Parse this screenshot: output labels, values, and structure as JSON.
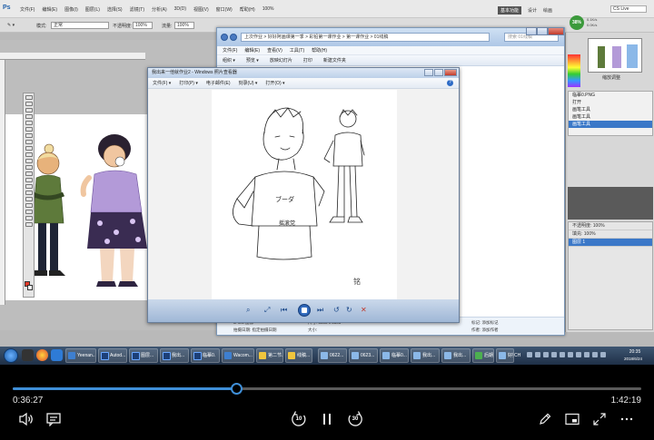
{
  "photoshop": {
    "logo": "Ps",
    "menus": [
      "文件(F)",
      "编辑(E)",
      "图像(I)",
      "图层(L)",
      "选择(S)",
      "滤镜(T)",
      "分析(A)",
      "3D(D)",
      "视图(V)",
      "窗口(W)",
      "帮助(H)"
    ],
    "workspace": {
      "active": "基本功能",
      "items": [
        "设计",
        "绘画"
      ]
    },
    "search_label": "CS Live",
    "zoom": "100%",
    "network": {
      "percent": "38%",
      "speed_up": "0.1K/s",
      "speed_down": "0.0K/s"
    },
    "options": {
      "mode_label": "模式:",
      "mode_value": "正常",
      "opacity_label": "不透明度:",
      "opacity_value": "100%",
      "flow_label": "流量:",
      "flow_value": "100%"
    },
    "navigator_caption": "缩放调整",
    "history": [
      "打开",
      "画笔工具",
      "画笔工具",
      "画笔工具"
    ],
    "history_file": "临摹0.PNG",
    "layers": {
      "opacity_label": "不透明度:",
      "opacity_value": "100%",
      "fill_label": "填充:",
      "fill_value": "100%",
      "layer_name": "图层 1"
    }
  },
  "explorer": {
    "address": "上次作业 > 好好阿画课第一季 > 彩铅第一课作业 > 第一课作业 > 01线稿",
    "search_placeholder": "搜索 01线稿",
    "menus": [
      "文件(F)",
      "编辑(E)",
      "查看(V)",
      "工具(T)",
      "帮助(H)"
    ],
    "commands": [
      "组织 ▾",
      "预览 ▾",
      "放映幻灯片",
      "打印",
      "新建文件夹"
    ],
    "status": {
      "type_label": "JPEG 图像",
      "taken_label": "拍摄日期:",
      "taken_value": "指定拍摄日期",
      "dimensions_label": "尺寸:",
      "dimensions_value": "3508 x 3508",
      "size_label": "大小:",
      "size_value": "",
      "tags_label": "标记:",
      "tags_value": "添加标记",
      "author_label": "作者:",
      "author_value": "添加作者"
    }
  },
  "viewer": {
    "title": "我出来一他就作业2 - Windows 照片查看器",
    "menus": [
      "文件(F) ▾",
      "打印(P) ▾",
      "电子邮件(E)",
      "刻录(U) ▾",
      "打开(O) ▾"
    ],
    "help": "?",
    "image_text": {
      "shirt_front": "ブーダ",
      "chest_label": "摇滚党",
      "signature": "铭"
    }
  },
  "taskbar": {
    "buttons": [
      "Yeenan...",
      "Autod...",
      "图层...",
      "我出...",
      "临摹0.",
      "Wacom...",
      "第二节...",
      "线稿...",
      "0622...",
      "0623...",
      "临摹0...",
      "我出...",
      "我出...",
      "后期...",
      "好好..."
    ],
    "lang": "CH",
    "time": "20:35",
    "date": "2018/6/24"
  },
  "player": {
    "elapsed": "0:36:27",
    "total": "1:42:19",
    "progress": 0.356,
    "skip_back": "10",
    "skip_forward": "30"
  },
  "colors": {
    "accent": "#3f8fd8",
    "foreground_swatch": "#e53b2b"
  }
}
